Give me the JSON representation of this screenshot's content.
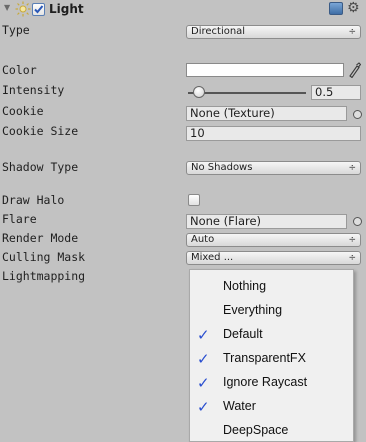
{
  "component": {
    "title": "Light",
    "enabled": true
  },
  "props": {
    "type_label": "Type",
    "type_value": "Directional",
    "color_label": "Color",
    "intensity_label": "Intensity",
    "intensity_value": "0.5",
    "intensity_fraction": 0.07,
    "cookie_label": "Cookie",
    "cookie_value": "None (Texture)",
    "cookie_size_label": "Cookie Size",
    "cookie_size_value": "10",
    "shadow_label": "Shadow Type",
    "shadow_value": "No Shadows",
    "halo_label": "Draw Halo",
    "halo_checked": false,
    "flare_label": "Flare",
    "flare_value": "None (Flare)",
    "render_mode_label": "Render Mode",
    "render_mode_value": "Auto",
    "culling_label": "Culling Mask",
    "culling_value": "Mixed ...",
    "lightmapping_label": "Lightmapping",
    "popup_arrows": "÷"
  },
  "culling_menu": [
    {
      "label": "Nothing",
      "checked": false
    },
    {
      "label": "Everything",
      "checked": false
    },
    {
      "label": "Default",
      "checked": true
    },
    {
      "label": "TransparentFX",
      "checked": true
    },
    {
      "label": "Ignore Raycast",
      "checked": true
    },
    {
      "label": "Water",
      "checked": true
    },
    {
      "label": "DeepSpace",
      "checked": false
    }
  ],
  "icons": {
    "foldout": "triangle-down",
    "component": "sun-icon",
    "help": "book-icon",
    "settings": "gear-icon",
    "check": "✓"
  }
}
